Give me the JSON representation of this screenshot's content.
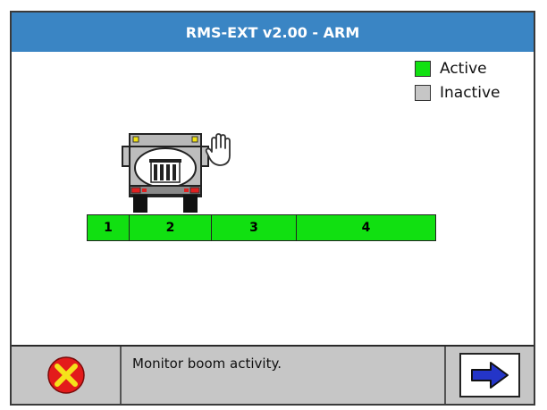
{
  "window": {
    "title": "RMS-EXT v2.00 - ARM"
  },
  "legend": [
    {
      "label": "Active",
      "color": "#11e011"
    },
    {
      "label": "Inactive",
      "color": "#c6c6c6"
    }
  ],
  "boom": {
    "segments": [
      {
        "label": "1",
        "state": "Active"
      },
      {
        "label": "2",
        "state": "Active"
      },
      {
        "label": "3",
        "state": "Active"
      },
      {
        "label": "4",
        "state": "Active"
      }
    ],
    "active_color": "#11e011"
  },
  "status": {
    "message": "Monitor boom activity."
  },
  "icons": {
    "cancel": "cancel-x-icon",
    "next": "arrow-right-icon",
    "vehicle": "tanker-truck-icon",
    "hand": "hand-stop-icon"
  },
  "colors": {
    "title_bar": "#3a85c4",
    "bottom_bar": "#c6c6c6",
    "cancel_red": "#e31b1b",
    "cancel_yellow": "#f5e21a",
    "arrow_blue": "#2435c8"
  }
}
